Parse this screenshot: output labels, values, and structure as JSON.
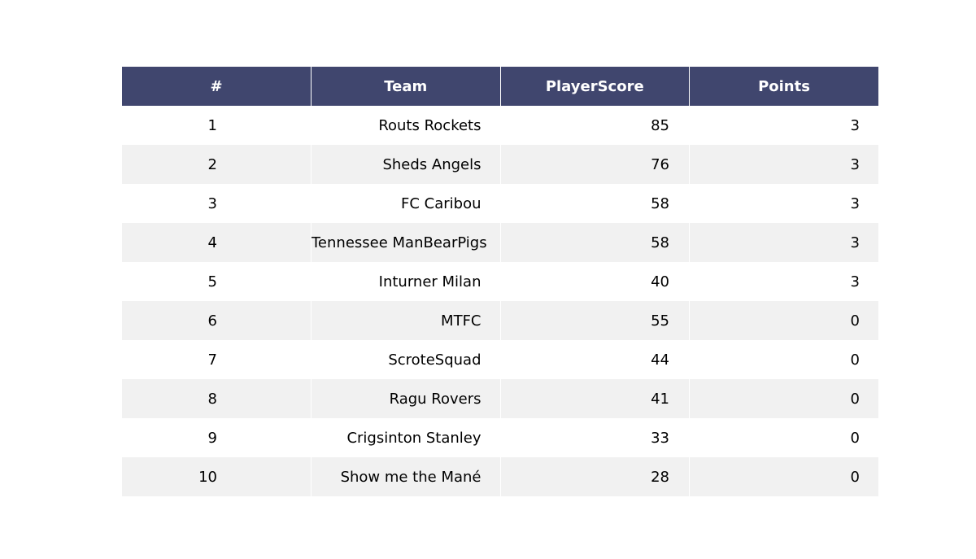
{
  "chart_data": {
    "type": "table",
    "columns": [
      "#",
      "Team",
      "PlayerScore",
      "Points"
    ],
    "rows": [
      [
        "1",
        "Routs Rockets",
        "85",
        "3"
      ],
      [
        "2",
        "Sheds Angels",
        "76",
        "3"
      ],
      [
        "3",
        "FC Caribou",
        "58",
        "3"
      ],
      [
        "4",
        "Tennessee ManBearPigs",
        "58",
        "3"
      ],
      [
        "5",
        "Inturner Milan",
        "40",
        "3"
      ],
      [
        "6",
        "MTFC",
        "55",
        "0"
      ],
      [
        "7",
        "ScroteSquad",
        "44",
        "0"
      ],
      [
        "8",
        "Ragu Rovers",
        "41",
        "0"
      ],
      [
        "9",
        "Crigsinton Stanley",
        "33",
        "0"
      ],
      [
        "10",
        "Show me the Mané",
        "28",
        "0"
      ]
    ]
  },
  "colors": {
    "header_bg": "#40466e",
    "header_text": "#ffffff",
    "row_alt_bg": "#f1f1f1",
    "row_bg": "#ffffff"
  }
}
